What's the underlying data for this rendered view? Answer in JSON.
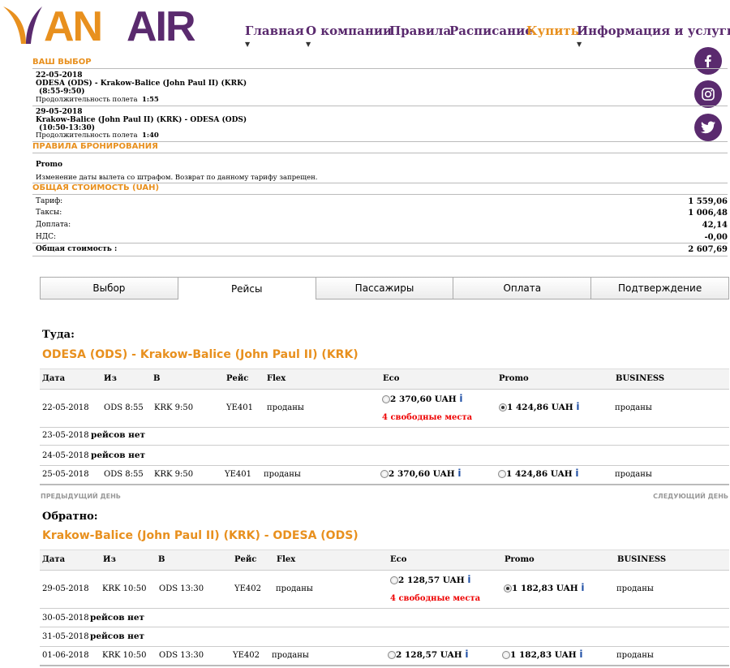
{
  "brand": {
    "logo_text": "YANAIR"
  },
  "nav": [
    {
      "label": "Главная"
    },
    {
      "label": "О компании"
    },
    {
      "label": "Правила"
    },
    {
      "label": "Расписание"
    },
    {
      "label": "Купить"
    },
    {
      "label": "Информация и услуги"
    }
  ],
  "summary": {
    "title": "ВАШ ВЫБОР",
    "outbound": {
      "date": "22-05-2018",
      "route": "ODESA (ODS)  -  Krakow-Balice (John Paul II)  (KRK)",
      "time": "(8:55-9:50)",
      "duration_label": "Продолжительность полета",
      "duration": "1:55"
    },
    "return": {
      "date": "29-05-2018",
      "route": "Krakow-Balice (John Paul II)  (KRK)  -  ODESA  (ODS)",
      "time": "(10:50-13:30)",
      "duration_label": "Продолжительность полета",
      "duration": "1:40"
    },
    "rules_title": "ПРАВИЛА БРОНИРОВАНИЯ",
    "fare_name": "Promo",
    "fare_rules": "Изменение даты вылета со штрафом. Возврат по данному тарифу запрещен.",
    "cost_title": "ОБЩАЯ СТОИМОСТЬ (UAH)",
    "costs": [
      {
        "label": "Тариф:",
        "value": "1 559,06"
      },
      {
        "label": "Таксы:",
        "value": "1 006,48"
      },
      {
        "label": "Доплата:",
        "value": "42,14"
      },
      {
        "label": "НДС:",
        "value": "-0,00"
      }
    ],
    "total_label": "Общая стоимость :",
    "total_value": "2 607,69"
  },
  "steps": [
    "Выбор",
    "Рейсы",
    "Пассажиры",
    "Оплата",
    "Подтверждение"
  ],
  "active_step": "Рейсы",
  "columns": {
    "date": "Дата",
    "from": "Из",
    "to": "В",
    "flight": "Рейс",
    "flex": "Flex",
    "eco": "Eco",
    "promo": "Promo",
    "business": "BUSINESS"
  },
  "outbound": {
    "label": "Туда:",
    "route": "ODESA (ODS) - Krakow-Balice (John Paul II) (KRK)",
    "rows": [
      {
        "date": "22-05-2018",
        "from": "ODS 8:55",
        "to": "KRK 9:50",
        "flight": "YE401",
        "flex": "проданы",
        "eco": "2 370,60 UAH",
        "promo": "1 424,86 UAH",
        "business": "проданы",
        "seats": "4 свободные места",
        "selected": "promo"
      },
      {
        "date": "23-05-2018",
        "none": "рейсов нет"
      },
      {
        "date": "24-05-2018",
        "none": "рейсов нет"
      },
      {
        "date": "25-05-2018",
        "from": "ODS 8:55",
        "to": "KRK 9:50",
        "flight": "YE401",
        "flex": "проданы",
        "eco": "2 370,60 UAH",
        "promo": "1 424,86 UAH",
        "business": "проданы"
      }
    ],
    "prev": "ПРЕДЫДУЩИЙ ДЕНЬ",
    "next": "СЛЕДУЮЩИЙ ДЕНЬ"
  },
  "return": {
    "label": "Обратно:",
    "route": "Krakow-Balice (John Paul II) (KRK) - ODESA (ODS)",
    "rows": [
      {
        "date": "29-05-2018",
        "from": "KRK 10:50",
        "to": "ODS 13:30",
        "flight": "YE402",
        "flex": "проданы",
        "eco": "2 128,57 UAH",
        "promo": "1 182,83 UAH",
        "business": "проданы",
        "seats": "4 свободные места",
        "selected": "promo"
      },
      {
        "date": "30-05-2018",
        "none": "рейсов нет"
      },
      {
        "date": "31-05-2018",
        "none": "рейсов нет"
      },
      {
        "date": "01-06-2018",
        "from": "KRK 10:50",
        "to": "ODS 13:30",
        "flight": "YE402",
        "flex": "проданы",
        "eco": "2 128,57 UAH",
        "promo": "1 182,83 UAH",
        "business": "проданы"
      }
    ]
  },
  "info_glyph": "i",
  "colors": {
    "brand_purple": "#5a2a6e",
    "brand_orange": "#e8901e",
    "seats_red": "#e00000",
    "info_blue": "#1f4fa5"
  }
}
